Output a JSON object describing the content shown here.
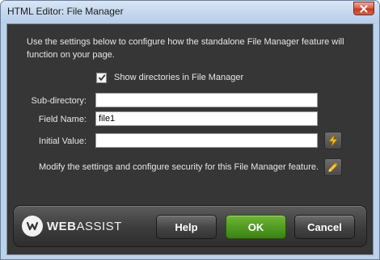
{
  "window": {
    "title": "HTML Editor: File Manager"
  },
  "description": "Use the settings below to configure how the standalone File Manager feature will function on your page.",
  "show_directories": {
    "label": "Show directories in File Manager",
    "checked": true
  },
  "fields": {
    "subdirectory": {
      "label": "Sub-directory:",
      "value": ""
    },
    "field_name": {
      "label": "Field Name:",
      "value": "file1"
    },
    "initial_value": {
      "label": "Initial Value:",
      "value": ""
    }
  },
  "icons": {
    "initial_value_button": "lightning-icon",
    "modify_button": "pencil-icon",
    "close_button": "close-icon",
    "logo": "webassist-logo"
  },
  "modify_text": "Modify the settings and configure security for this File Manager feature.",
  "footer": {
    "logo_text_bold": "WEB",
    "logo_text_rest": "ASSIST",
    "help_label": "Help",
    "ok_label": "OK",
    "cancel_label": "Cancel"
  },
  "colors": {
    "panel_background": "#363636",
    "frame": "#bcd2ec",
    "ok_button": "#4f9a22",
    "close_button": "#c2381f"
  }
}
